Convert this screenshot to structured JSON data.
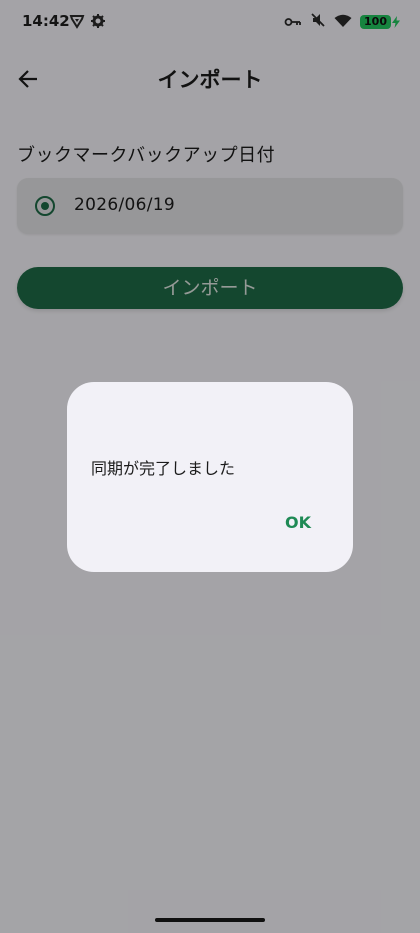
{
  "status_bar": {
    "time": "14:42",
    "battery_level": "100",
    "left_icons": [
      "shield-app-icon",
      "gear-icon"
    ],
    "right_icons": [
      "key-icon",
      "mute-icon",
      "wifi-icon",
      "battery-icon"
    ],
    "battery_color": "#22c55e"
  },
  "app_bar": {
    "back_icon": "arrow-left-icon",
    "title": "インポート"
  },
  "backup_section": {
    "label": "ブックマークバックアップ日付",
    "options": [
      {
        "date": "2026/06/19",
        "selected": true
      }
    ]
  },
  "import_button": {
    "label": "インポート",
    "color": "#1f6b46"
  },
  "dialog": {
    "message": "同期が完了しました",
    "ok_label": "OK",
    "ok_color": "#1f8a55"
  }
}
